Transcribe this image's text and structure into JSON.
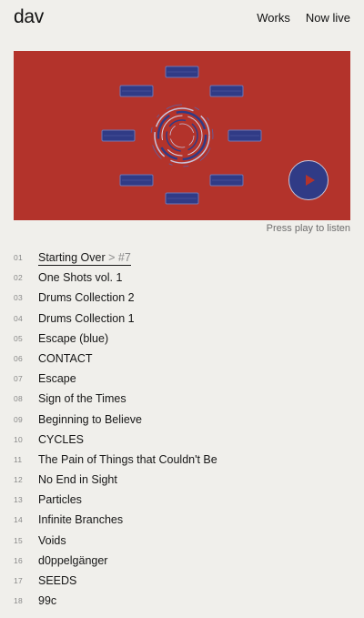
{
  "header": {
    "logo": "dav",
    "nav": [
      {
        "label": "Works"
      },
      {
        "label": "Now live"
      }
    ]
  },
  "player": {
    "background_color": "#b3332b",
    "accent_color": "#303b86",
    "caption": "Press play to listen",
    "play_icon": "play-icon"
  },
  "tracks": [
    {
      "number": "01",
      "title": "Starting Over",
      "suffix": " > #7",
      "active": true
    },
    {
      "number": "02",
      "title": "One Shots vol. 1"
    },
    {
      "number": "03",
      "title": "Drums Collection 2"
    },
    {
      "number": "04",
      "title": "Drums Collection 1"
    },
    {
      "number": "05",
      "title": "Escape (blue)"
    },
    {
      "number": "06",
      "title": "CONTACT"
    },
    {
      "number": "07",
      "title": "Escape"
    },
    {
      "number": "08",
      "title": "Sign of the Times"
    },
    {
      "number": "09",
      "title": "Beginning to Believe"
    },
    {
      "number": "10",
      "title": "CYCLES"
    },
    {
      "number": "11",
      "title": "The Pain of Things that Couldn't Be"
    },
    {
      "number": "12",
      "title": "No End in Sight"
    },
    {
      "number": "13",
      "title": "Particles"
    },
    {
      "number": "14",
      "title": "Infinite Branches"
    },
    {
      "number": "15",
      "title": "Voids"
    },
    {
      "number": "16",
      "title": "d0ppelgänger"
    },
    {
      "number": "17",
      "title": "SEEDS"
    },
    {
      "number": "18",
      "title": "99c"
    }
  ]
}
